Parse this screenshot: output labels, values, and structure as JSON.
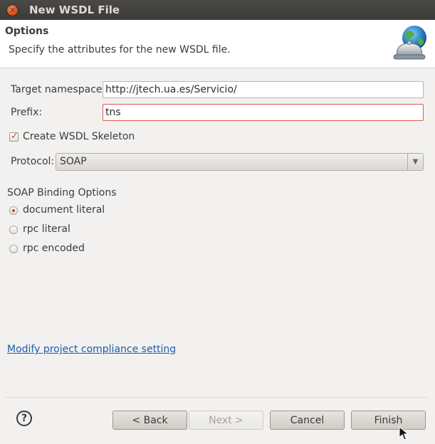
{
  "window": {
    "title": "New WSDL File"
  },
  "header": {
    "title": "Options",
    "description": "Specify the attributes for the new WSDL file.",
    "icon": "globe-bell-icon"
  },
  "form": {
    "namespace_label": "Target namespace:",
    "namespace_value": "http://jtech.ua.es/Servicio/",
    "prefix_label": "Prefix:",
    "prefix_value": "tns",
    "skeleton_label": "Create WSDL Skeleton",
    "skeleton_checked": true,
    "protocol_label": "Protocol:",
    "protocol_value": "SOAP"
  },
  "binding": {
    "section_label": "SOAP Binding Options",
    "options": [
      {
        "label": "document literal",
        "selected": true
      },
      {
        "label": "rpc literal",
        "selected": false
      },
      {
        "label": "rpc encoded",
        "selected": false
      }
    ]
  },
  "compliance_link": "Modify project compliance setting",
  "footer": {
    "help": "?",
    "back_label": "< Back",
    "next_label": "Next >",
    "cancel_label": "Cancel",
    "finish_label": "Finish"
  },
  "colors": {
    "accent": "#d0462a",
    "link": "#1b5bb0",
    "titlebar": "#3c3b37",
    "error_border": "#e05a4b"
  }
}
